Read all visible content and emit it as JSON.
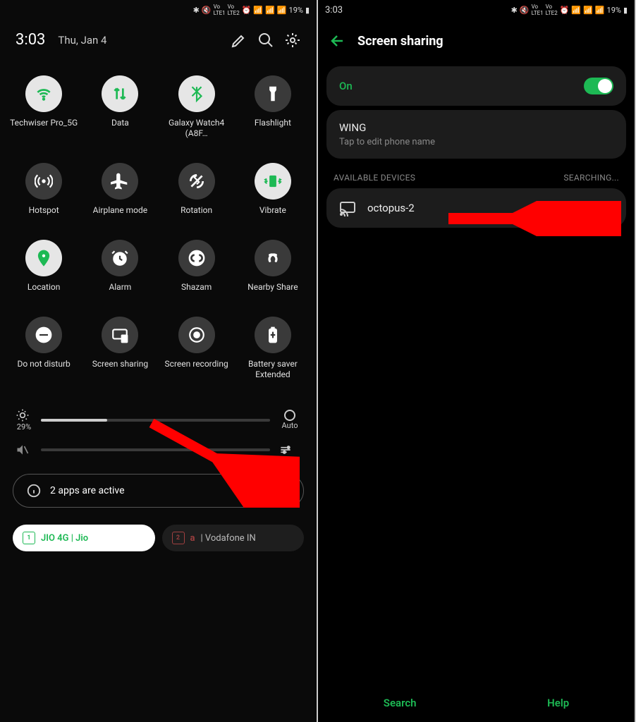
{
  "status": {
    "time": "3:03",
    "battery": "19%"
  },
  "qs": {
    "time": "3:03",
    "date": "Thu, Jan 4",
    "tiles": [
      {
        "label": "Techwiser Pro_5G",
        "icon": "wifi",
        "on": true,
        "green": true
      },
      {
        "label": "Data",
        "icon": "data",
        "on": true,
        "green": true
      },
      {
        "label": "Galaxy Watch4 (A8F…",
        "icon": "bluetooth",
        "on": true,
        "green": true
      },
      {
        "label": "Flashlight",
        "icon": "flashlight",
        "on": false
      },
      {
        "label": "Hotspot",
        "icon": "hotspot",
        "on": false
      },
      {
        "label": "Airplane mode",
        "icon": "airplane",
        "on": false
      },
      {
        "label": "Rotation",
        "icon": "rotation",
        "on": false
      },
      {
        "label": "Vibrate",
        "icon": "vibrate",
        "on": true,
        "green": true
      },
      {
        "label": "Location",
        "icon": "location",
        "on": true,
        "green": true
      },
      {
        "label": "Alarm",
        "icon": "alarm",
        "on": false
      },
      {
        "label": "Shazam",
        "icon": "shazam",
        "on": false
      },
      {
        "label": "Nearby Share",
        "icon": "nearby",
        "on": false
      },
      {
        "label": "Do not disturb",
        "icon": "dnd",
        "on": false
      },
      {
        "label": "Screen sharing",
        "icon": "cast",
        "on": false
      },
      {
        "label": "Screen recording",
        "icon": "record",
        "on": false
      },
      {
        "label": "Battery saver Extended",
        "icon": "battery",
        "on": false
      }
    ],
    "brightness": {
      "value": 29,
      "label": "29%",
      "auto": "Auto"
    },
    "active_apps": "2 apps are active",
    "sim1": "JIO 4G | Jio",
    "sim2_badge": "a",
    "sim2": "| Vodafone IN"
  },
  "right": {
    "title": "Screen sharing",
    "on_label": "On",
    "phone": {
      "name": "WING",
      "hint": "Tap to edit phone name"
    },
    "section": "AVAILABLE DEVICES",
    "searching": "SEARCHING...",
    "device": "octopus-2",
    "actions": {
      "search": "Search",
      "help": "Help"
    }
  }
}
